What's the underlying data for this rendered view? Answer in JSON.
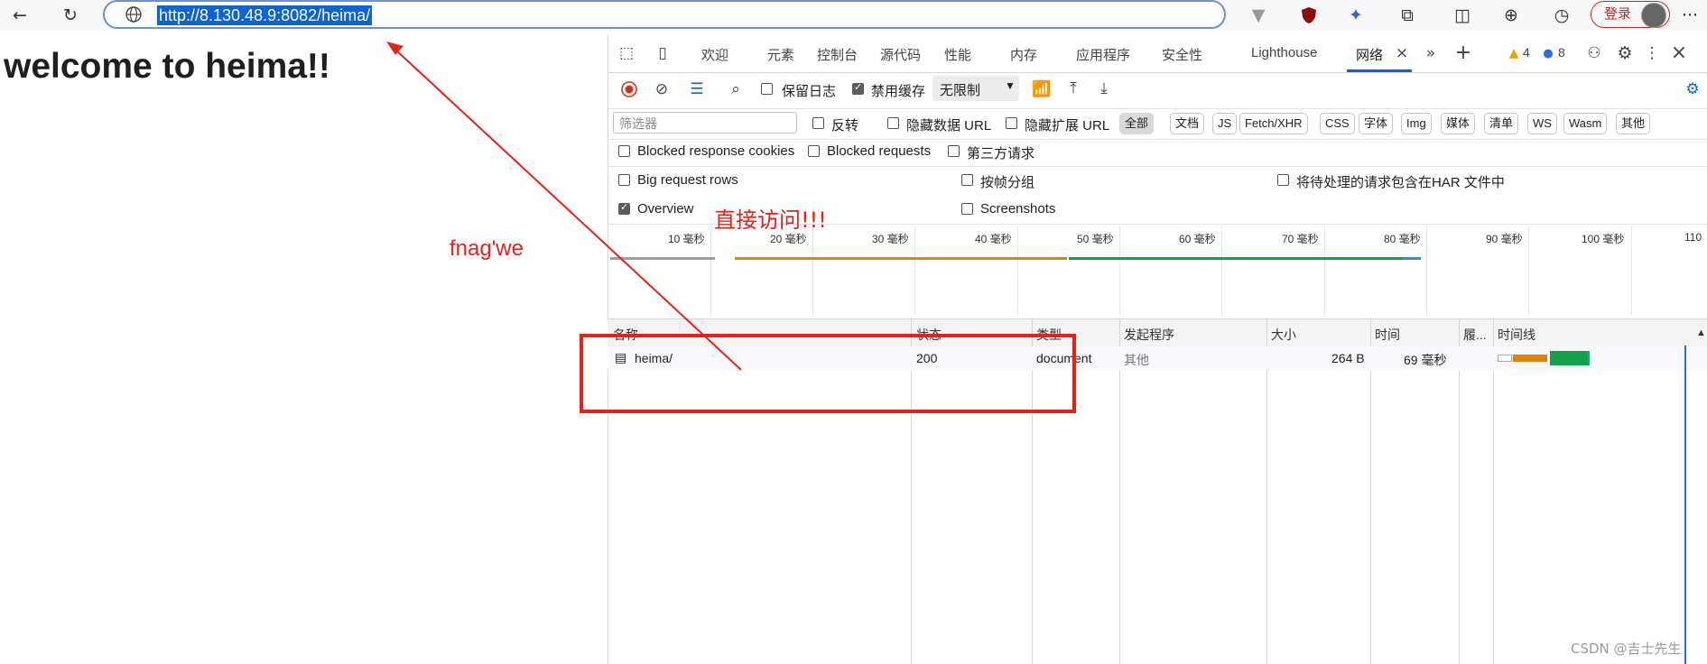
{
  "browser": {
    "url": "http://8.130.48.9:8082/heima/",
    "login_label": "登录",
    "more_label": "···"
  },
  "page": {
    "heading": "welcome to heima!!"
  },
  "devtools": {
    "tabs": [
      "欢迎",
      "元素",
      "控制台",
      "源代码",
      "性能",
      "内存",
      "应用程序",
      "安全性",
      "Lighthouse",
      "网络"
    ],
    "active_tab": "网络",
    "warning_count": "4",
    "message_count": "8",
    "toolbar": {
      "preserve_log": "保留日志",
      "disable_cache": "禁用缓存",
      "throttle": "无限制"
    },
    "filter": {
      "placeholder": "筛选器",
      "invert": "反转",
      "hide_data_urls": "隐藏数据 URL",
      "hide_ext_urls": "隐藏扩展 URL",
      "types": [
        "全部",
        "文档",
        "JS",
        "Fetch/XHR",
        "CSS",
        "字体",
        "Img",
        "媒体",
        "清单",
        "WS",
        "Wasm",
        "其他"
      ],
      "active_type": "全部"
    },
    "options": {
      "blocked_cookies": "Blocked response cookies",
      "blocked_requests": "Blocked requests",
      "third_party": "第三方请求",
      "big_rows": "Big request rows",
      "group_by_frame": "按帧分组",
      "har_pending": "将待处理的请求包含在HAR 文件中",
      "overview": "Overview",
      "screenshots": "Screenshots"
    },
    "timeline_ticks": [
      "10 毫秒",
      "20 毫秒",
      "30 毫秒",
      "40 毫秒",
      "50 毫秒",
      "60 毫秒",
      "70 毫秒",
      "80 毫秒",
      "90 毫秒",
      "100 毫秒",
      "110"
    ],
    "table": {
      "columns": [
        "名称",
        "状态",
        "类型",
        "发起程序",
        "大小",
        "时间",
        "履...",
        "时间线"
      ],
      "rows": [
        {
          "name": "heima/",
          "status": "200",
          "type": "document",
          "initiator": "其他",
          "size": "264 B",
          "time": "69 毫秒"
        }
      ]
    }
  },
  "annotations": {
    "direct_access": "直接访问!!!",
    "scribble": "fnag'we"
  },
  "watermark": "CSDN @吉士先生",
  "colors": {
    "annotation_red": "#e8201a",
    "accent_blue": "#0b63d6"
  }
}
